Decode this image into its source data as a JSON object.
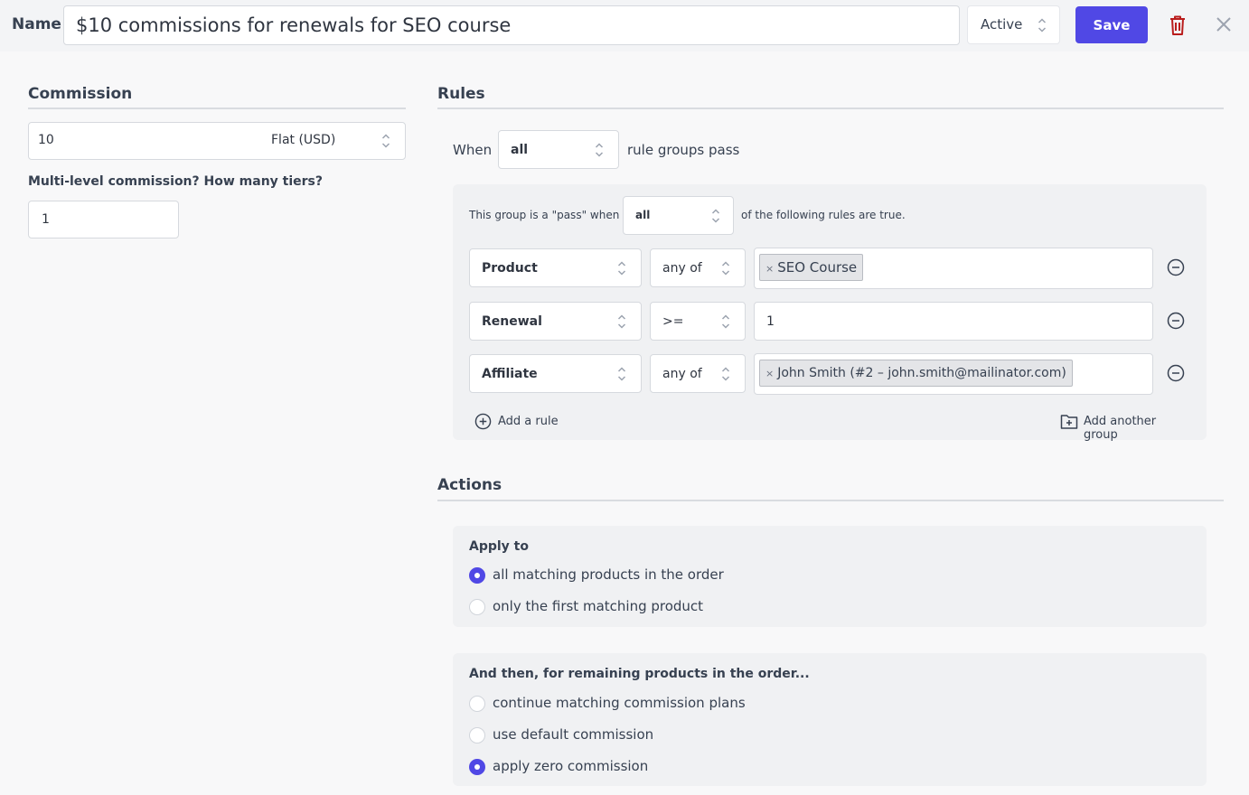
{
  "header": {
    "name_label": "Name",
    "name_value": "$10 commissions for renewals for SEO course",
    "status": "Active",
    "save_label": "Save"
  },
  "commission": {
    "title": "Commission",
    "amount": "10",
    "type": "Flat (USD)",
    "tiers_label": "Multi-level commission? How many tiers?",
    "tiers_value": "1"
  },
  "rules": {
    "title": "Rules",
    "when_label": "When",
    "when_value": "all",
    "when_suffix": "rule groups pass",
    "group": {
      "prefix": "This group is a \"pass\" when",
      "match": "all",
      "suffix": "of the following rules are true.",
      "items": [
        {
          "field": "Product",
          "operator": "any of",
          "tag": "SEO Course"
        },
        {
          "field": "Renewal",
          "operator": ">=",
          "value": "1"
        },
        {
          "field": "Affiliate",
          "operator": "any of",
          "tag": "John Smith (#2 – john.smith@mailinator.com)"
        }
      ],
      "add_rule": "Add a rule",
      "add_group": "Add another group"
    }
  },
  "actions": {
    "title": "Actions",
    "apply_to": {
      "label": "Apply to",
      "options": [
        {
          "label": "all matching products in the order",
          "selected": true
        },
        {
          "label": "only the first matching product",
          "selected": false
        }
      ]
    },
    "then": {
      "label": "And then, for remaining products in the order...",
      "options": [
        {
          "label": "continue matching commission plans",
          "selected": false
        },
        {
          "label": "use default commission",
          "selected": false
        },
        {
          "label": "apply zero commission",
          "selected": true
        }
      ]
    }
  },
  "colors": {
    "accent": "#5048e5",
    "danger": "#b91c1c",
    "background": "#f8f8f9"
  },
  "icons": [
    "updown-chevron-icon",
    "trash-icon",
    "close-icon",
    "minus-circle-icon",
    "plus-circle-icon",
    "folder-plus-icon",
    "tag-remove-icon"
  ]
}
